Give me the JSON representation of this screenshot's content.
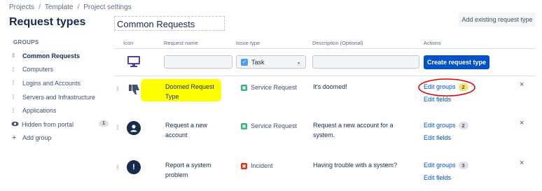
{
  "breadcrumbs": [
    "Projects",
    "Template",
    "Project settings"
  ],
  "page_title": "Request types",
  "sidebar": {
    "heading": "GROUPS",
    "items": [
      {
        "label": "Common Requests"
      },
      {
        "label": "Computers"
      },
      {
        "label": "Logins and Accounts"
      },
      {
        "label": "Servers and Infrastructure"
      },
      {
        "label": "Applications"
      },
      {
        "label": "Hidden from portal",
        "count": "1"
      }
    ],
    "add_group_label": "Add group"
  },
  "main": {
    "group_name": "Common Requests",
    "add_existing_label": "Add existing request type",
    "columns": {
      "icon": "Icon",
      "request_name": "Request name",
      "issue_type": "Issue type",
      "description": "Description (Optional)",
      "actions": "Actions"
    },
    "create_row": {
      "name_value": "",
      "issue_type_value": "Task",
      "description_value": "",
      "create_button_label": "Create request type"
    },
    "rows": [
      {
        "icon": "thumbs-down-icon",
        "name": "Doomed Request Type",
        "issue_type": "Service Request",
        "description": "It's doomed!",
        "edit_groups_label": "Edit groups",
        "group_count": "2",
        "edit_fields_label": "Edit fields"
      },
      {
        "icon": "user-icon",
        "name": "Request a new account",
        "issue_type": "Service Request",
        "description": "Request a new account for a system.",
        "edit_groups_label": "Edit groups",
        "group_count": "2",
        "edit_fields_label": "Edit fields"
      },
      {
        "icon": "exclamation-icon",
        "name": "Report a system problem",
        "issue_type": "Incident",
        "description": "Having trouble with a system?",
        "edit_groups_label": "Edit groups",
        "group_count": "3",
        "edit_fields_label": "Edit fields"
      }
    ],
    "remove_symbol": "×"
  },
  "colors": {
    "primary": "#0052cc",
    "highlight": "#ffff00",
    "annotation": "#e00000",
    "service_request": "#36b37e",
    "incident": "#de350b"
  }
}
